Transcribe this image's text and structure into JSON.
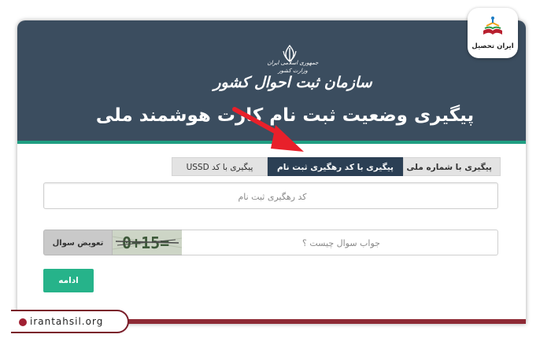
{
  "header": {
    "gov_line1": "جمهوری اسلامی ایران",
    "gov_line2": "وزارت کشور",
    "org_name": "سازمان ثبت احوال کشور",
    "page_title": "پیگیری وضعیت ثبت نام کارت هوشمند ملی"
  },
  "tabs": [
    {
      "label": "پیگیری با کد USSD",
      "active": false
    },
    {
      "label": "پیگیری با کد رهگیری ثبت نام",
      "active": true
    },
    {
      "label": "پیگیری با شماره ملی",
      "active": false
    }
  ],
  "form": {
    "tracking_placeholder": "کد رهگیری ثبت نام",
    "answer_placeholder": "جواب سوال چیست ؟",
    "change_question_label": "تعویض سوال",
    "captcha_text": "0+15=",
    "continue_label": "ادامه"
  },
  "branding": {
    "badge_name": "ایران تحصیل",
    "website": "irantahsil.org"
  },
  "colors": {
    "header_bg": "#3b4d5f",
    "accent_green": "#26b38a",
    "active_tab": "#2b3f54",
    "brand_red": "#a01f32"
  },
  "icons": {
    "emblem": "iran-emblem-icon",
    "arrow": "red-arrow-annotation",
    "globe": "globe-icon"
  }
}
